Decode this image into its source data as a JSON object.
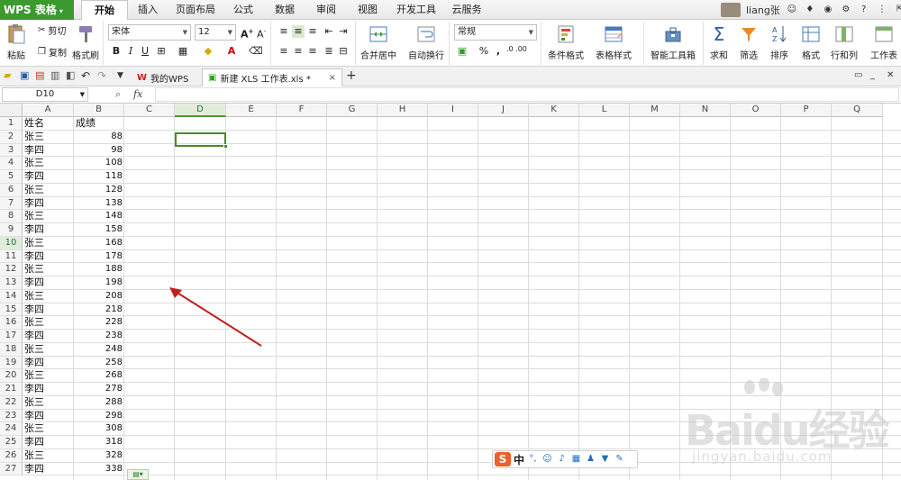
{
  "app": {
    "logo": "WPS 表格",
    "logo_dd": "▾"
  },
  "menu": {
    "tabs": [
      "开始",
      "插入",
      "页面布局",
      "公式",
      "数据",
      "审阅",
      "视图",
      "开发工具",
      "云服务"
    ],
    "active_index": 0
  },
  "user": {
    "name": "liang张"
  },
  "ribbon": {
    "paste": "粘贴",
    "cut": "剪切",
    "copy": "复制",
    "format_painter": "格式刷",
    "font_name": "宋体",
    "font_size": "12",
    "bold": "B",
    "italic": "I",
    "underline": "U",
    "merge_center": "合并居中",
    "wrap_text": "自动换行",
    "number_format": "常规",
    "percent": "%",
    "comma": ",",
    "inc_decimal": ".0 .00",
    "dec_decimal": ".00 .0",
    "conditional_format": "条件格式",
    "table_style": "表格样式",
    "smart_toolbox": "智能工具箱",
    "sum": "求和",
    "filter": "筛选",
    "sort": "排序",
    "format": "格式",
    "row_col": "行和列",
    "worksheet": "工作表"
  },
  "doc_tabs": [
    {
      "label": "我的WPS",
      "active": false
    },
    {
      "label": "新建 XLS 工作表.xls *",
      "active": true
    }
  ],
  "formula_bar": {
    "name_box": "D10",
    "fx": "fx",
    "formula": ""
  },
  "columns": [
    "A",
    "B",
    "C",
    "D",
    "E",
    "F",
    "G",
    "H",
    "I",
    "J",
    "K",
    "L",
    "M",
    "N",
    "O",
    "P",
    "Q"
  ],
  "selected_column": "D",
  "selected_row": 10,
  "rows": [
    {
      "n": "1",
      "a": "姓名",
      "b": "成绩",
      "b_left": true
    },
    {
      "n": "2",
      "a": "张三",
      "b": "88"
    },
    {
      "n": "3",
      "a": "李四",
      "b": "98"
    },
    {
      "n": "4",
      "a": "张三",
      "b": "108"
    },
    {
      "n": "5",
      "a": "李四",
      "b": "118"
    },
    {
      "n": "6",
      "a": "张三",
      "b": "128"
    },
    {
      "n": "7",
      "a": "李四",
      "b": "138"
    },
    {
      "n": "8",
      "a": "张三",
      "b": "148"
    },
    {
      "n": "9",
      "a": "李四",
      "b": "158"
    },
    {
      "n": "10",
      "a": "张三",
      "b": "168"
    },
    {
      "n": "11",
      "a": "李四",
      "b": "178"
    },
    {
      "n": "12",
      "a": "张三",
      "b": "188"
    },
    {
      "n": "13",
      "a": "李四",
      "b": "198"
    },
    {
      "n": "14",
      "a": "张三",
      "b": "208"
    },
    {
      "n": "15",
      "a": "李四",
      "b": "218"
    },
    {
      "n": "16",
      "a": "张三",
      "b": "228"
    },
    {
      "n": "17",
      "a": "李四",
      "b": "238"
    },
    {
      "n": "18",
      "a": "张三",
      "b": "248"
    },
    {
      "n": "19",
      "a": "李四",
      "b": "258"
    },
    {
      "n": "20",
      "a": "张三",
      "b": "268"
    },
    {
      "n": "21",
      "a": "李四",
      "b": "278"
    },
    {
      "n": "22",
      "a": "张三",
      "b": "288"
    },
    {
      "n": "23",
      "a": "李四",
      "b": "298"
    },
    {
      "n": "24",
      "a": "张三",
      "b": "308"
    },
    {
      "n": "25",
      "a": "李四",
      "b": "318"
    },
    {
      "n": "26",
      "a": "张三",
      "b": "328"
    },
    {
      "n": "27",
      "a": "李四",
      "b": "338"
    }
  ],
  "ime": {
    "logo": "S",
    "lang": "中",
    "punct": "°,"
  },
  "watermark": {
    "brand": "Baidu经验",
    "url": "jingyan.baidu.com"
  },
  "colors": {
    "accent": "#3a9a2e",
    "selection": "#4a8a2a",
    "annotation_arrow": "#c0201c"
  }
}
